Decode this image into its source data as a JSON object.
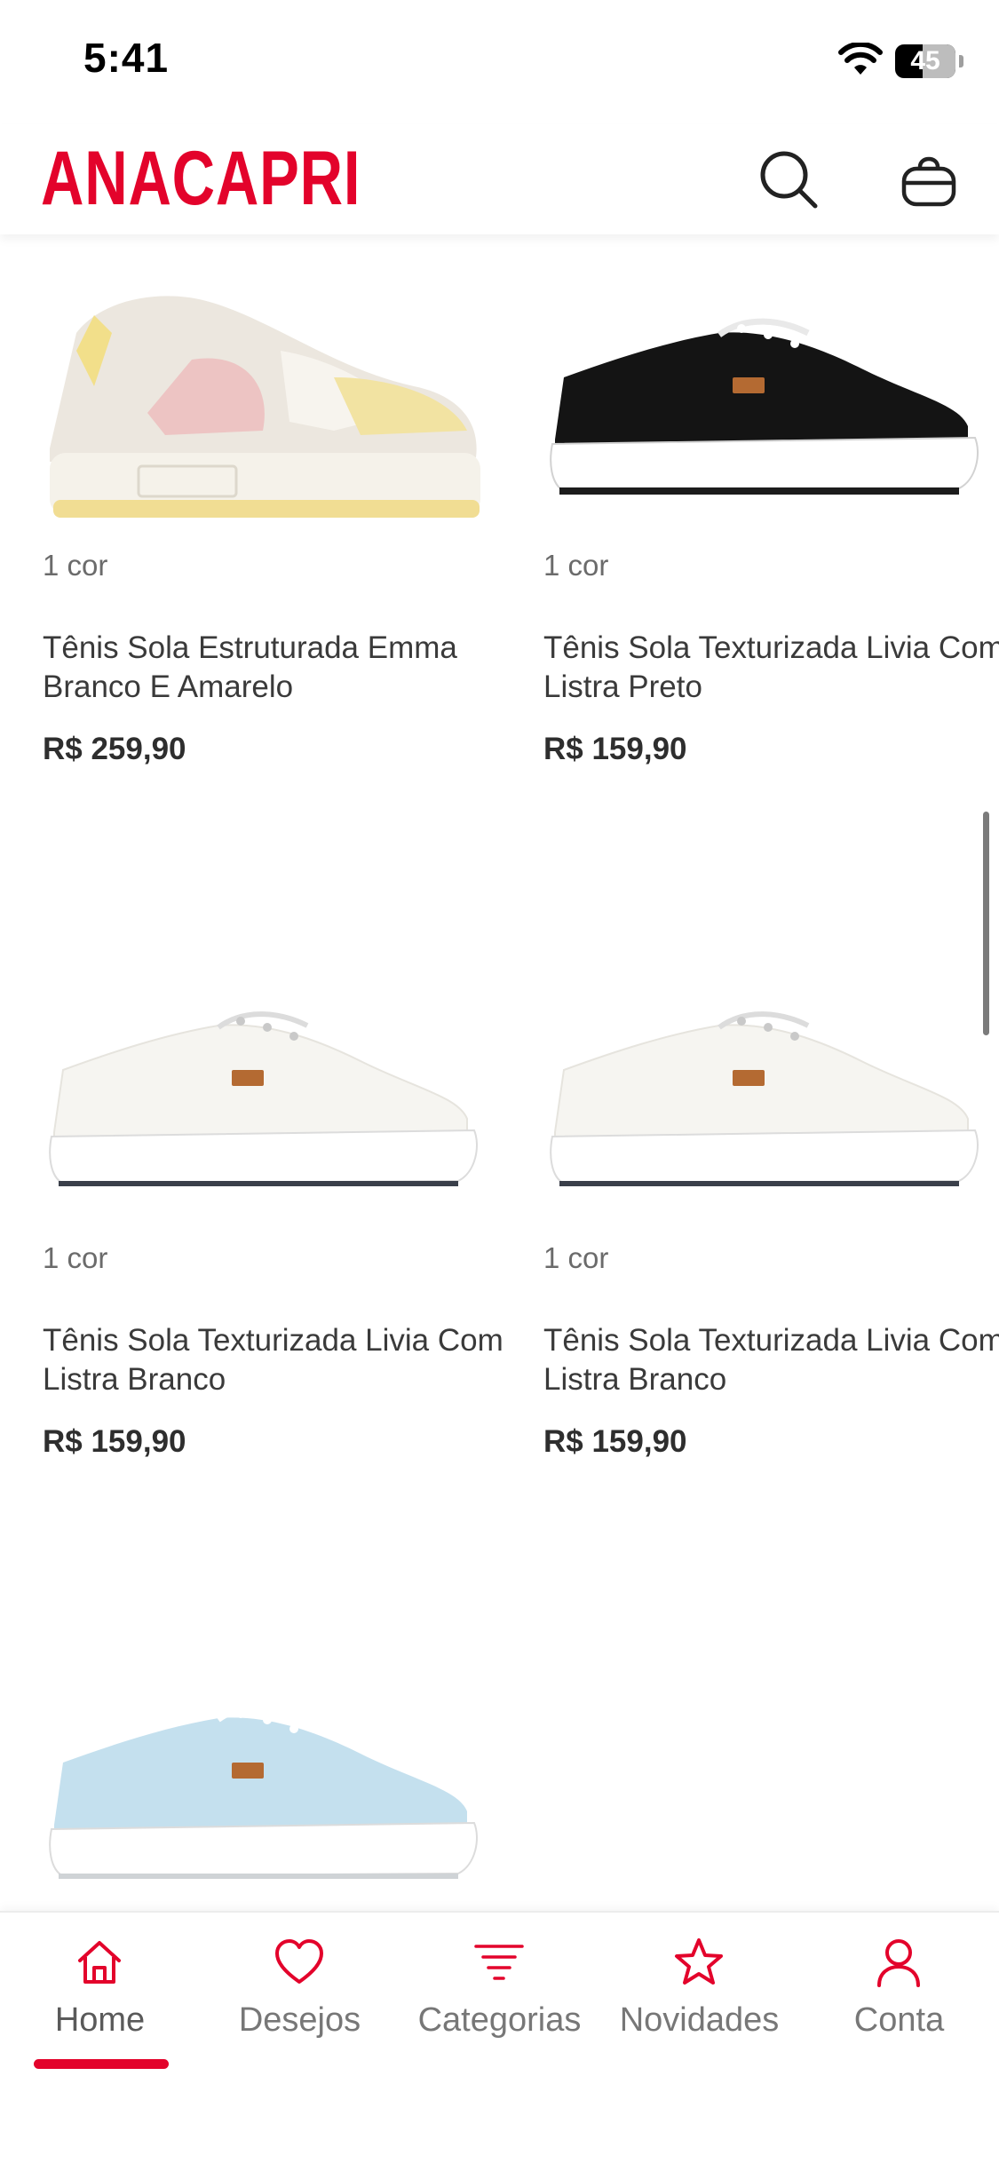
{
  "status_bar": {
    "time": "5:41",
    "battery": "45",
    "battery_level": 0.45
  },
  "header": {
    "brand": "ANACAPRI",
    "brand_color": "#e3032b",
    "icons": [
      "search-icon",
      "bag-icon"
    ]
  },
  "products": [
    {
      "colors": "1 cor",
      "name": "Tênis Sola Estruturada Emma Branco E Amarelo",
      "price": "R$ 259,90",
      "shoe_color": "white-yellow-pink"
    },
    {
      "colors": "1 cor",
      "name": "Tênis Sola Texturizada Livia Com Listra Preto",
      "price": "R$ 159,90",
      "shoe_color": "black"
    },
    {
      "colors": "1 cor",
      "name": "Tênis Sola Texturizada Livia Com Listra Branco",
      "price": "R$ 159,90",
      "shoe_color": "white"
    },
    {
      "colors": "1 cor",
      "name": "Tênis Sola Texturizada Livia Com Listra Branco",
      "price": "R$ 159,90",
      "shoe_color": "white"
    },
    {
      "shoe_color": "light-blue"
    }
  ],
  "tabbar": {
    "active": "Home",
    "accent": "#e3032b",
    "tabs": [
      {
        "label": "Home",
        "icon": "home-icon"
      },
      {
        "label": "Desejos",
        "icon": "heart-icon"
      },
      {
        "label": "Categorias",
        "icon": "filter-lines-icon"
      },
      {
        "label": "Novidades",
        "icon": "star-icon"
      },
      {
        "label": "Conta",
        "icon": "user-icon"
      }
    ]
  }
}
